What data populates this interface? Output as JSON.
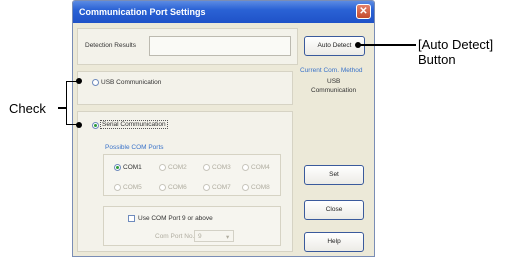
{
  "window": {
    "title": "Communication Port Settings",
    "close_glyph": "✕"
  },
  "detection": {
    "label": "Detection Results",
    "value": "",
    "auto_detect_label": "Auto Detect"
  },
  "current_method": {
    "heading": "Current Com. Method",
    "line1": "USB",
    "line2": "Communication"
  },
  "usb_option": {
    "label": "USB Communication",
    "selected": false
  },
  "serial_option": {
    "label": "Serial Communication",
    "selected": true
  },
  "ports": {
    "heading": "Possible COM Ports",
    "items": [
      {
        "label": "COM1",
        "selected": true,
        "enabled": true
      },
      {
        "label": "COM2",
        "selected": false,
        "enabled": false
      },
      {
        "label": "COM3",
        "selected": false,
        "enabled": false
      },
      {
        "label": "COM4",
        "selected": false,
        "enabled": false
      },
      {
        "label": "COM5",
        "selected": false,
        "enabled": false
      },
      {
        "label": "COM6",
        "selected": false,
        "enabled": false
      },
      {
        "label": "COM7",
        "selected": false,
        "enabled": false
      },
      {
        "label": "COM8",
        "selected": false,
        "enabled": false
      }
    ]
  },
  "com9": {
    "checkbox_label": "Use COM Port 9 or above",
    "port_no_label": "Com Port No.",
    "port_no_value": "9"
  },
  "buttons": {
    "set": "Set",
    "close": "Close",
    "help": "Help"
  },
  "annotations": {
    "auto_detect_line1": "[Auto Detect]",
    "auto_detect_line2": "Button",
    "check": "Check"
  }
}
